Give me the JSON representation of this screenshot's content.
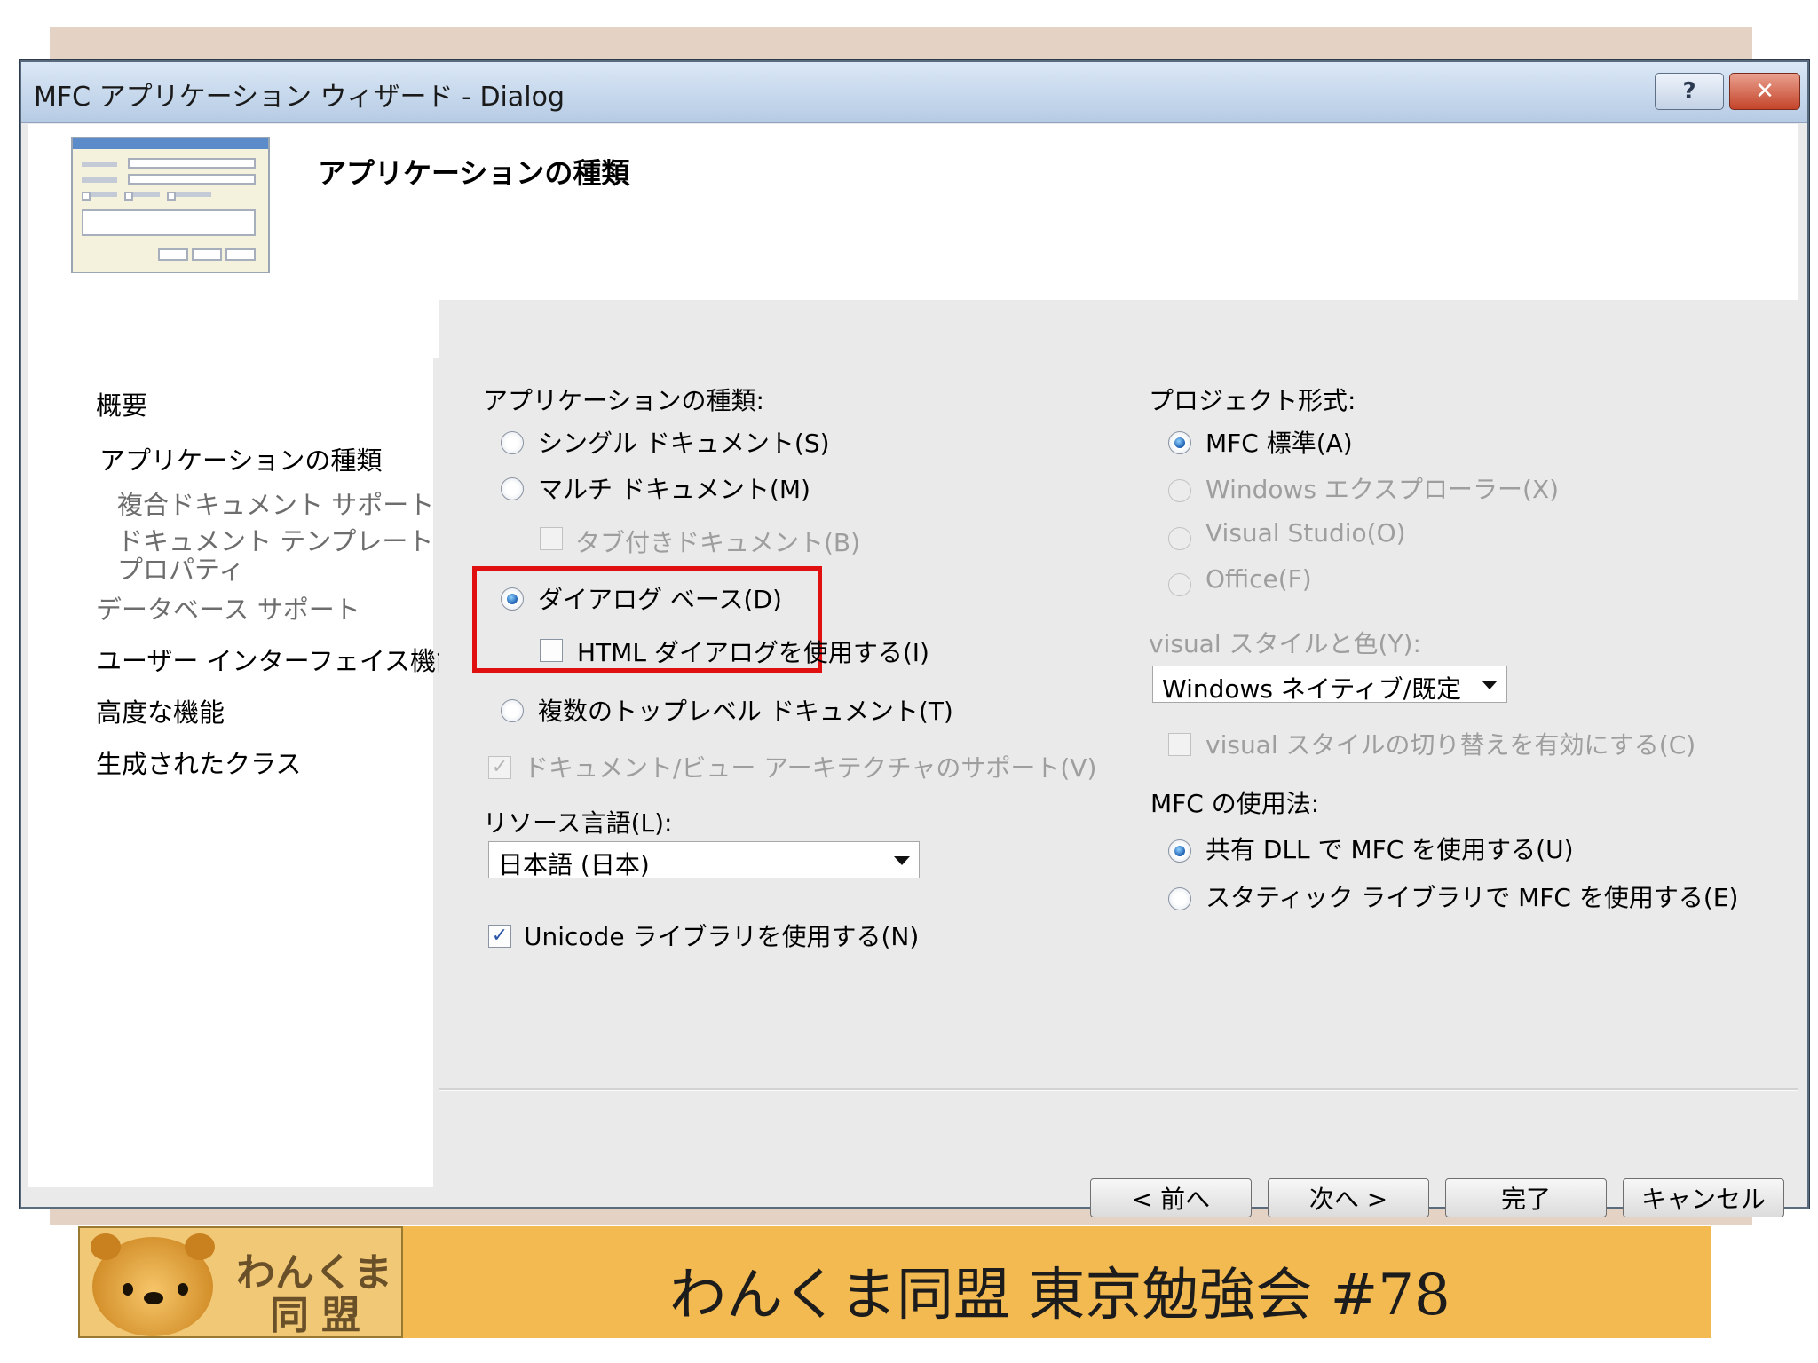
{
  "window": {
    "title": "MFC アプリケーション ウィザード - Dialog",
    "help_glyph": "?",
    "close_glyph": "✕"
  },
  "header": {
    "title": "アプリケーションの種類"
  },
  "nav": {
    "items": [
      {
        "label": "概要"
      },
      {
        "label": "アプリケーションの種類"
      },
      {
        "label": "複合ドキュメント サポート"
      },
      {
        "label": "ドキュメント テンプレート プロパティ"
      },
      {
        "label": "データベース サポート"
      },
      {
        "label": "ユーザー インターフェイス機能"
      },
      {
        "label": "高度な機能"
      },
      {
        "label": "生成されたクラス"
      }
    ]
  },
  "app_type": {
    "group_label": "アプリケーションの種類:",
    "single_doc": "シングル ドキュメント(S)",
    "multi_doc": "マルチ ドキュメント(M)",
    "tabbed_doc": "タブ付きドキュメント(B)",
    "dialog_based": "ダイアログ ベース(D)",
    "use_html_dialog": "HTML ダイアログを使用する(I)",
    "multi_toplevel": "複数のトップレベル ドキュメント(T)",
    "doc_view_support": "ドキュメント/ビュー アーキテクチャのサポート(V)",
    "selected": "dialog_based"
  },
  "resource_lang": {
    "label": "リソース言語(L):",
    "value": "日本語 (日本)"
  },
  "unicode": {
    "label": "Unicode ライブラリを使用する(N)",
    "checked": true
  },
  "project_style": {
    "group_label": "プロジェクト形式:",
    "mfc_standard": "MFC 標準(A)",
    "explorer": "Windows エクスプローラー(X)",
    "visual_studio": "Visual Studio(O)",
    "office": "Office(F)",
    "selected": "mfc_standard"
  },
  "visual_style": {
    "label": "visual スタイルと色(Y):",
    "value": "Windows ネイティブ/既定",
    "enable_switch": "visual スタイルの切り替えを有効にする(C)"
  },
  "mfc_usage": {
    "group_label": "MFC の使用法:",
    "shared_dll": "共有 DLL で MFC を使用する(U)",
    "static_lib": "スタティック ライブラリで MFC を使用する(E)",
    "selected": "shared_dll"
  },
  "buttons": {
    "prev": "< 前へ",
    "next": "次へ >",
    "finish": "完了",
    "cancel": "キャンセル"
  },
  "footer": {
    "title": "わんくま同盟 東京勉強会 #78",
    "logo_line1": "わんくま",
    "logo_line2": "同盟"
  }
}
